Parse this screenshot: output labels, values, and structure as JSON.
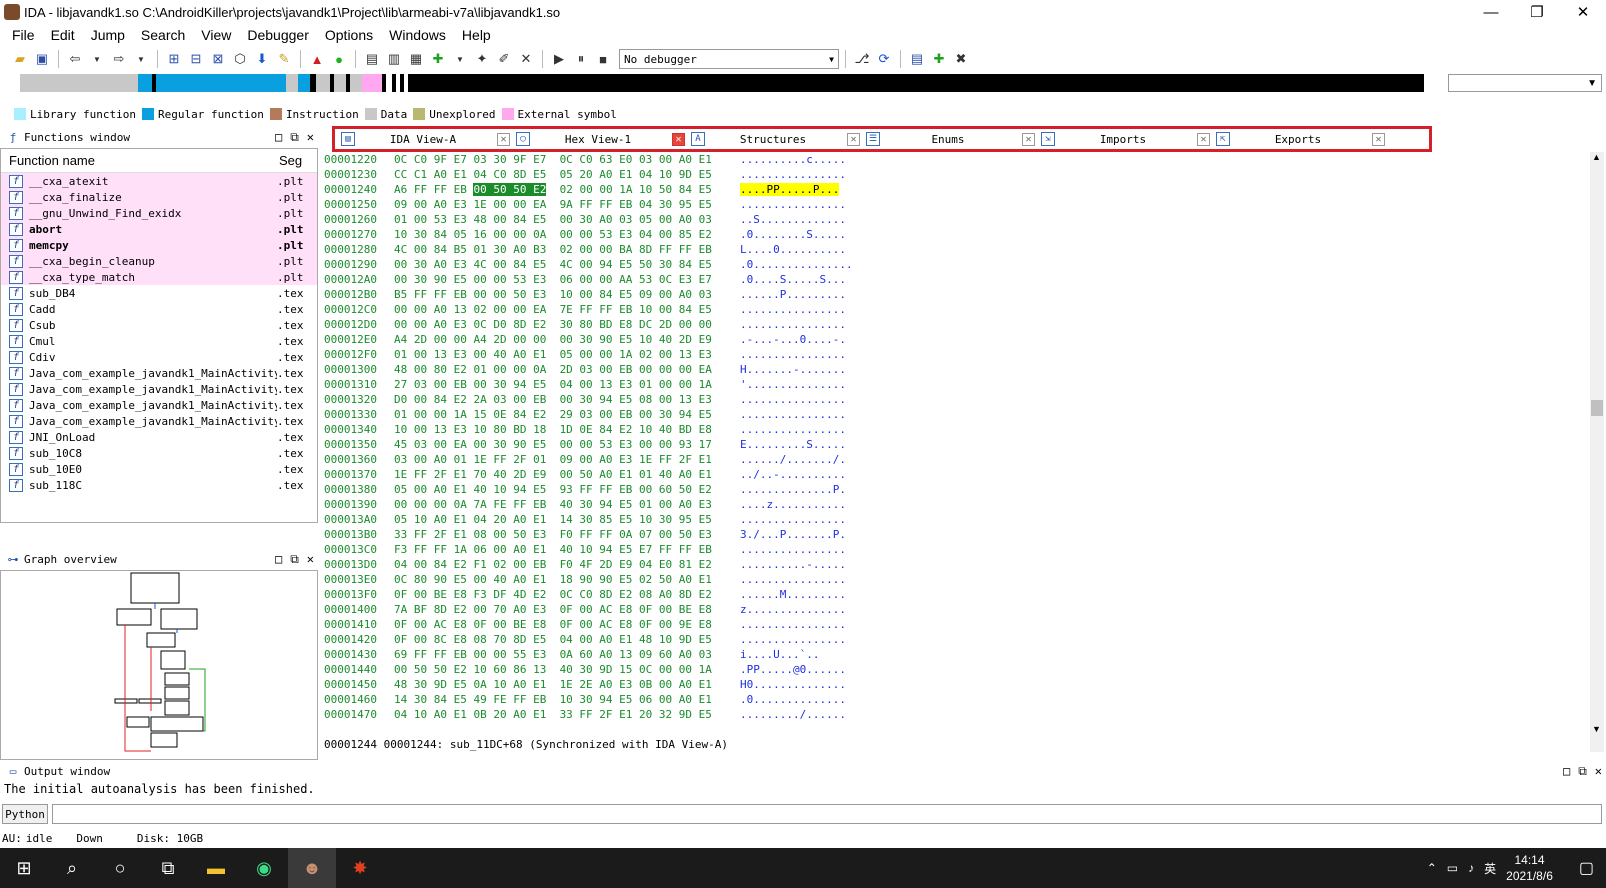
{
  "window": {
    "title": "IDA - libjavandk1.so C:\\AndroidKiller\\projects\\javandk1\\Project\\lib\\armeabi-v7a\\libjavandk1.so",
    "minimize": "—",
    "maximize": "❐",
    "close": "✕"
  },
  "menu": [
    "File",
    "Edit",
    "Jump",
    "Search",
    "View",
    "Debugger",
    "Options",
    "Windows",
    "Help"
  ],
  "toolbar": {
    "debugger_select": "No debugger"
  },
  "legend": [
    {
      "label": "Library function",
      "color": "#a8f0ff"
    },
    {
      "label": "Regular function",
      "color": "#0aa0e0"
    },
    {
      "label": "Instruction",
      "color": "#b47a5a"
    },
    {
      "label": "Data",
      "color": "#c8c8c8"
    },
    {
      "label": "Unexplored",
      "color": "#b8b870"
    },
    {
      "label": "External symbol",
      "color": "#ffa8f0"
    }
  ],
  "functions_window": {
    "title": "Functions window",
    "col_name": "Function name",
    "col_seg": "Seg",
    "rows": [
      {
        "name": "__cxa_atexit",
        "seg": ".plt",
        "bold": false,
        "pink": true
      },
      {
        "name": "__cxa_finalize",
        "seg": ".plt",
        "bold": false,
        "pink": true
      },
      {
        "name": "__gnu_Unwind_Find_exidx",
        "seg": ".plt",
        "bold": false,
        "pink": true
      },
      {
        "name": "abort",
        "seg": ".plt",
        "bold": true,
        "pink": true
      },
      {
        "name": "memcpy",
        "seg": ".plt",
        "bold": true,
        "pink": true
      },
      {
        "name": "__cxa_begin_cleanup",
        "seg": ".plt",
        "bold": false,
        "pink": true
      },
      {
        "name": "__cxa_type_match",
        "seg": ".plt",
        "bold": false,
        "pink": true
      },
      {
        "name": "sub_DB4",
        "seg": ".tex",
        "bold": false,
        "pink": false
      },
      {
        "name": "Cadd",
        "seg": ".tex",
        "bold": false,
        "pink": false
      },
      {
        "name": "Csub",
        "seg": ".tex",
        "bold": false,
        "pink": false
      },
      {
        "name": "Cmul",
        "seg": ".tex",
        "bold": false,
        "pink": false
      },
      {
        "name": "Cdiv",
        "seg": ".tex",
        "bold": false,
        "pink": false
      },
      {
        "name": "Java_com_example_javandk1_MainActivity…",
        "seg": ".tex",
        "bold": false,
        "pink": false
      },
      {
        "name": "Java_com_example_javandk1_MainActivity…",
        "seg": ".tex",
        "bold": false,
        "pink": false
      },
      {
        "name": "Java_com_example_javandk1_MainActivity…",
        "seg": ".tex",
        "bold": false,
        "pink": false
      },
      {
        "name": "Java_com_example_javandk1_MainActivity…",
        "seg": ".tex",
        "bold": false,
        "pink": false
      },
      {
        "name": "JNI_OnLoad",
        "seg": ".tex",
        "bold": false,
        "pink": false
      },
      {
        "name": "sub_10C8",
        "seg": ".tex",
        "bold": false,
        "pink": false
      },
      {
        "name": "sub_10E0",
        "seg": ".tex",
        "bold": false,
        "pink": false
      },
      {
        "name": "sub_118C",
        "seg": ".tex",
        "bold": false,
        "pink": false
      }
    ]
  },
  "graph_overview": {
    "title": "Graph overview"
  },
  "tabs": [
    {
      "label": "IDA View-A",
      "icon": "ida-view-icon",
      "active": false
    },
    {
      "label": "Hex View-1",
      "icon": "hex-view-icon",
      "active": true
    },
    {
      "label": "Structures",
      "icon": "structures-icon",
      "active": false
    },
    {
      "label": "Enums",
      "icon": "enums-icon",
      "active": false
    },
    {
      "label": "Imports",
      "icon": "imports-icon",
      "active": false
    },
    {
      "label": "Exports",
      "icon": "exports-icon",
      "active": false
    }
  ],
  "hex_rows": [
    {
      "addr": "00001220",
      "bytes": "0C C0 9F E7 03 30 9F E7  0C C0 63 E0 03 00 A0 E1",
      "ascii": "..........c....."
    },
    {
      "addr": "00001230",
      "bytes": "CC C1 A0 E1 04 C0 8D E5  05 20 A0 E1 04 10 9D E5",
      "ascii": "................"
    },
    {
      "addr": "00001240",
      "bytes_pre": "A6 FF FF EB ",
      "bytes_sel": "00 50 50 E2",
      "bytes_post": "  02 00 00 1A 10 50 84 E5",
      "ascii": "....PP.....P..."
    },
    {
      "addr": "00001250",
      "bytes": "09 00 A0 E3 1E 00 00 EA  9A FF FF EB 04 30 95 E5",
      "ascii": "................"
    },
    {
      "addr": "00001260",
      "bytes": "01 00 53 E3 48 00 84 E5  00 30 A0 03 05 00 A0 03",
      "ascii": "..S............."
    },
    {
      "addr": "00001270",
      "bytes": "10 30 84 05 16 00 00 0A  00 00 53 E3 04 00 85 E2",
      "ascii": ".0........S....."
    },
    {
      "addr": "00001280",
      "bytes": "4C 00 84 B5 01 30 A0 B3  02 00 00 BA 8D FF FF EB",
      "ascii": "L....0.........."
    },
    {
      "addr": "00001290",
      "bytes": "00 30 A0 E3 4C 00 84 E5  4C 00 94 E5 50 30 84 E5",
      "ascii": ".0..............."
    },
    {
      "addr": "000012A0",
      "bytes": "00 30 90 E5 00 00 53 E3  06 00 00 AA 53 0C E3 E7",
      "ascii": ".0....S.....S..."
    },
    {
      "addr": "000012B0",
      "bytes": "B5 FF FF EB 00 00 50 E3  10 00 84 E5 09 00 A0 03",
      "ascii": "......P........."
    },
    {
      "addr": "000012C0",
      "bytes": "00 00 A0 13 02 00 00 EA  7E FF FF EB 10 00 84 E5",
      "ascii": "................"
    },
    {
      "addr": "000012D0",
      "bytes": "00 00 A0 E3 0C D0 8D E2  30 80 BD E8 DC 2D 00 00",
      "ascii": "................"
    },
    {
      "addr": "000012E0",
      "bytes": "A4 2D 00 00 A4 2D 00 00  00 30 90 E5 10 40 2D E9",
      "ascii": ".-...-...0....-."
    },
    {
      "addr": "000012F0",
      "bytes": "01 00 13 E3 00 40 A0 E1  05 00 00 1A 02 00 13 E3",
      "ascii": "................"
    },
    {
      "addr": "00001300",
      "bytes": "48 00 80 E2 01 00 00 0A  2D 03 00 EB 00 00 00 EA",
      "ascii": "H.......-......."
    },
    {
      "addr": "00001310",
      "bytes": "27 03 00 EB 00 30 94 E5  04 00 13 E3 01 00 00 1A",
      "ascii": "'..............."
    },
    {
      "addr": "00001320",
      "bytes": "D0 00 84 E2 2A 03 00 EB  00 30 94 E5 08 00 13 E3",
      "ascii": "................"
    },
    {
      "addr": "00001330",
      "bytes": "01 00 00 1A 15 0E 84 E2  29 03 00 EB 00 30 94 E5",
      "ascii": "................"
    },
    {
      "addr": "00001340",
      "bytes": "10 00 13 E3 10 80 BD 18  1D 0E 84 E2 10 40 BD E8",
      "ascii": "................"
    },
    {
      "addr": "00001350",
      "bytes": "45 03 00 EA 00 30 90 E5  00 00 53 E3 00 00 93 17",
      "ascii": "E.........S....."
    },
    {
      "addr": "00001360",
      "bytes": "03 00 A0 01 1E FF 2F 01  09 00 A0 E3 1E FF 2F E1",
      "ascii": "....../......./."
    },
    {
      "addr": "00001370",
      "bytes": "1E FF 2F E1 70 40 2D E9  00 50 A0 E1 01 40 A0 E1",
      "ascii": "../..-.........."
    },
    {
      "addr": "00001380",
      "bytes": "05 00 A0 E1 40 10 94 E5  93 FF FF EB 00 60 50 E2",
      "ascii": "..............P."
    },
    {
      "addr": "00001390",
      "bytes": "00 00 00 0A 7A FE FF EB  40 30 94 E5 01 00 A0 E3",
      "ascii": "....z..........."
    },
    {
      "addr": "000013A0",
      "bytes": "05 10 A0 E1 04 20 A0 E1  14 30 85 E5 10 30 95 E5",
      "ascii": "................"
    },
    {
      "addr": "000013B0",
      "bytes": "33 FF 2F E1 08 00 50 E3  F0 FF FF 0A 07 00 50 E3",
      "ascii": "3./...P.......P."
    },
    {
      "addr": "000013C0",
      "bytes": "F3 FF FF 1A 06 00 A0 E1  40 10 94 E5 E7 FF FF EB",
      "ascii": "................"
    },
    {
      "addr": "000013D0",
      "bytes": "04 00 84 E2 F1 02 00 EB  F0 4F 2D E9 04 E0 81 E2",
      "ascii": "..........-....."
    },
    {
      "addr": "000013E0",
      "bytes": "0C 80 90 E5 00 40 A0 E1  18 90 90 E5 02 50 A0 E1",
      "ascii": "................"
    },
    {
      "addr": "000013F0",
      "bytes": "0F 00 BE E8 F3 DF 4D E2  0C C0 8D E2 08 A0 8D E2",
      "ascii": "......M........."
    },
    {
      "addr": "00001400",
      "bytes": "7A BF 8D E2 00 70 A0 E3  0F 00 AC E8 0F 00 BE E8",
      "ascii": "z..............."
    },
    {
      "addr": "00001410",
      "bytes": "0F 00 AC E8 0F 00 BE E8  0F 00 AC E8 0F 00 9E E8",
      "ascii": "................"
    },
    {
      "addr": "00001420",
      "bytes": "0F 00 8C E8 08 70 8D E5  04 00 A0 E1 48 10 9D E5",
      "ascii": "................"
    },
    {
      "addr": "00001430",
      "bytes": "69 FF FF EB 00 00 55 E3  0A 60 A0 13 09 60 A0 03",
      "ascii": "i....U...`.."
    },
    {
      "addr": "00001440",
      "bytes": "00 50 50 E2 10 60 86 13  40 30 9D 15 0C 00 00 1A",
      "ascii": ".PP.....@0......"
    },
    {
      "addr": "00001450",
      "bytes": "48 30 9D E5 0A 10 A0 E1  1E 2E A0 E3 0B 00 A0 E1",
      "ascii": "H0.............."
    },
    {
      "addr": "00001460",
      "bytes": "14 30 84 E5 49 FE FF EB  10 30 94 E5 06 00 A0 E1",
      "ascii": ".0.............."
    },
    {
      "addr": "00001470",
      "bytes": "04 10 A0 E1 0B 20 A0 E1  33 FF 2F E1 20 32 9D E5",
      "ascii": "........./......"
    }
  ],
  "hex_status": "00001244 00001244: sub_11DC+68 (Synchronized with IDA View-A)",
  "output_window": {
    "title": "Output window",
    "text": "The initial autoanalysis has been finished.",
    "python_button": "Python"
  },
  "status_bar": {
    "au_label": "AU:",
    "au_value": "idle",
    "direction": "Down",
    "disk": "Disk: 10GB"
  },
  "taskbar": {
    "time": "14:14",
    "date": "2021/8/6",
    "ime": "英"
  }
}
